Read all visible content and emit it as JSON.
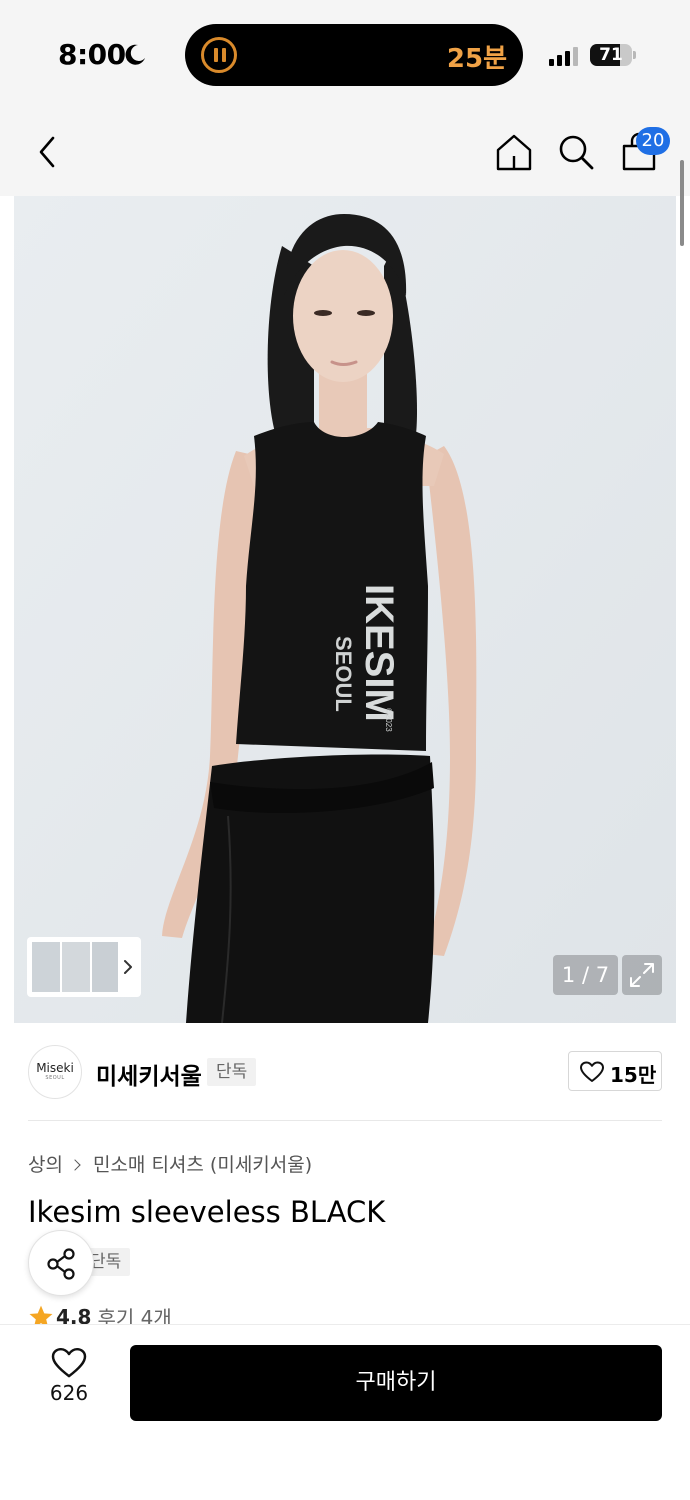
{
  "status_bar": {
    "time": "8:00",
    "live_activity_text": "25분",
    "battery_level": "71",
    "battery_fraction": 0.71
  },
  "nav": {
    "cart_count": "20",
    "icons": [
      "back-arrow-icon",
      "home-icon",
      "search-icon",
      "shopping-bag-icon"
    ]
  },
  "gallery": {
    "counter": "1 / 7",
    "current_image": 1,
    "total_images": 7,
    "print_text_main": "IKESIM",
    "print_text_sub": "SEOUL",
    "print_year": "©2023"
  },
  "brand": {
    "logo_text": "Miseki",
    "logo_subtext": "SEOUL",
    "name": "미세키서울",
    "exclusive_label": "단독",
    "like_count": "15만"
  },
  "product": {
    "breadcrumb": [
      "상의",
      "민소매 티셔츠 (미세키서울)"
    ],
    "title": "Ikesim sleeveless BLACK",
    "exclusive_label": "단독",
    "rating": "4.8",
    "review_label": "후기 4개"
  },
  "bottom_bar": {
    "wish_count": "626",
    "buy_label": "구매하기"
  },
  "colors": {
    "accent_badge": "#1f6fe5",
    "star": "#f5a623",
    "live_activity": "#f0a246",
    "buy_button": "#000000"
  }
}
